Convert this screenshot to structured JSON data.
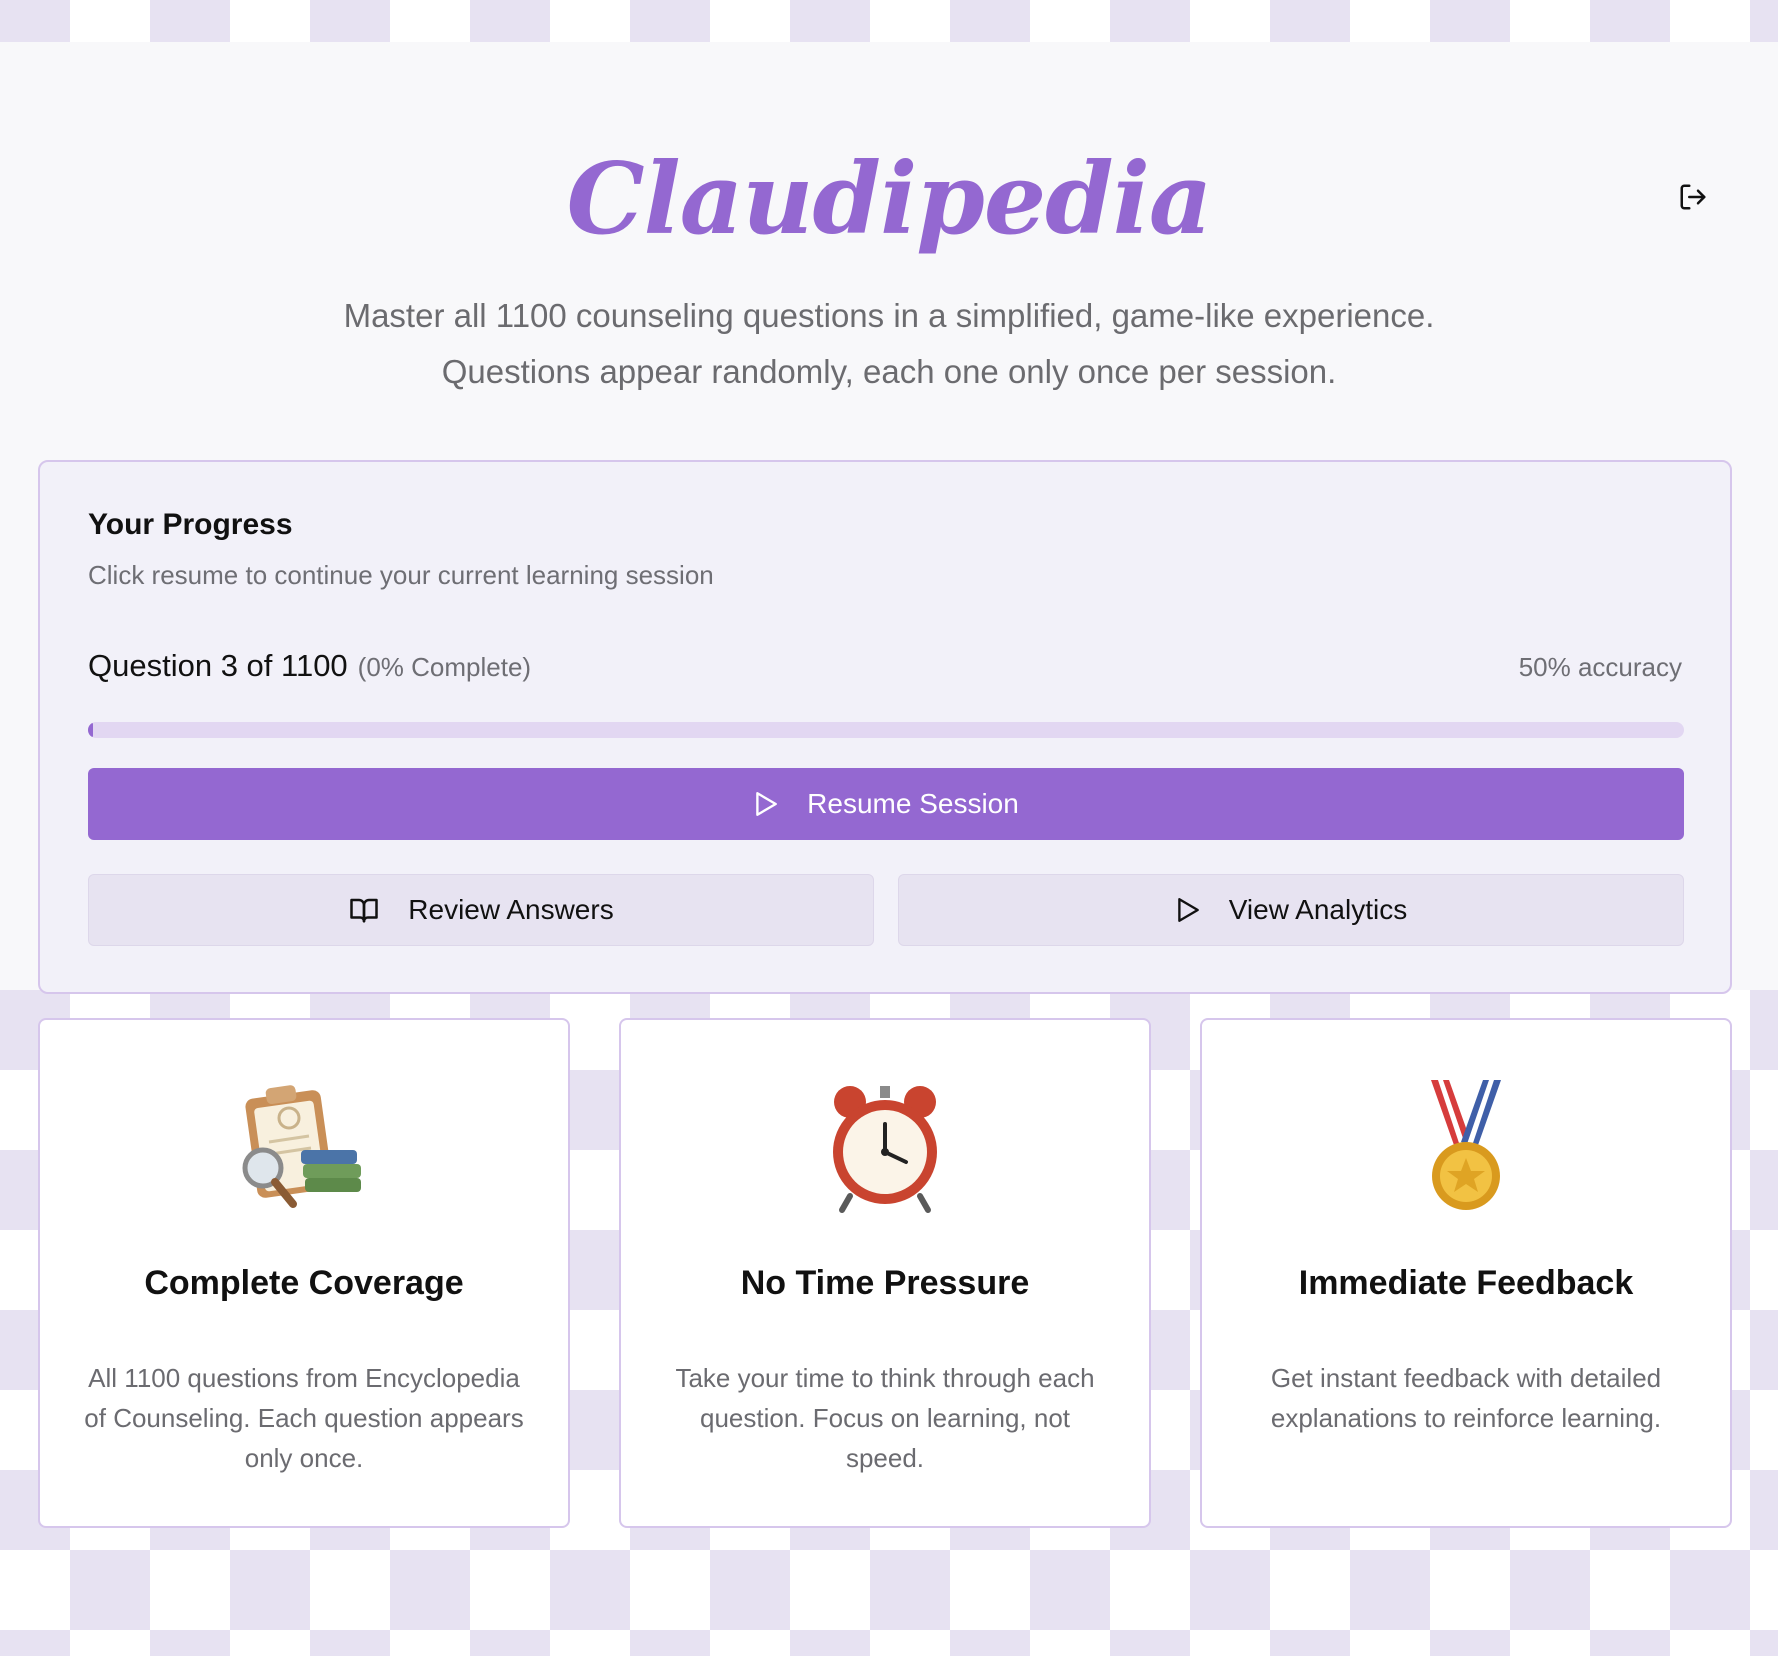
{
  "header": {
    "brand": "Claudipedia",
    "subtitle_line1": "Master all 1100 counseling questions in a simplified, game-like experience.",
    "subtitle_line2": "Questions appear randomly, each one only once per session.",
    "logout_icon": "logout-icon"
  },
  "progress": {
    "title": "Your Progress",
    "description": "Click resume to continue your current learning session",
    "question_label": "Question 3 of 1100",
    "percent_label": "(0% Complete)",
    "accuracy_label": "50% accuracy",
    "fill_fraction": 0.002,
    "resume_label": "Resume Session",
    "review_label": "Review Answers",
    "analytics_label": "View Analytics"
  },
  "features": [
    {
      "icon": "clipboard-books-icon",
      "title": "Complete Coverage",
      "description": "All 1100 questions from Encyclopedia of Counseling. Each question appears only once."
    },
    {
      "icon": "alarm-clock-icon",
      "title": "No Time Pressure",
      "description": "Take your time to think through each question. Focus on learning, not speed."
    },
    {
      "icon": "medal-icon",
      "title": "Immediate Feedback",
      "description": "Get instant feedback with detailed explanations to reinforce learning."
    }
  ],
  "colors": {
    "accent": "#9468d1",
    "progress_track": "#e2d7f2",
    "card_border": "#d6c6ec",
    "muted_text": "#6b6b6f"
  }
}
